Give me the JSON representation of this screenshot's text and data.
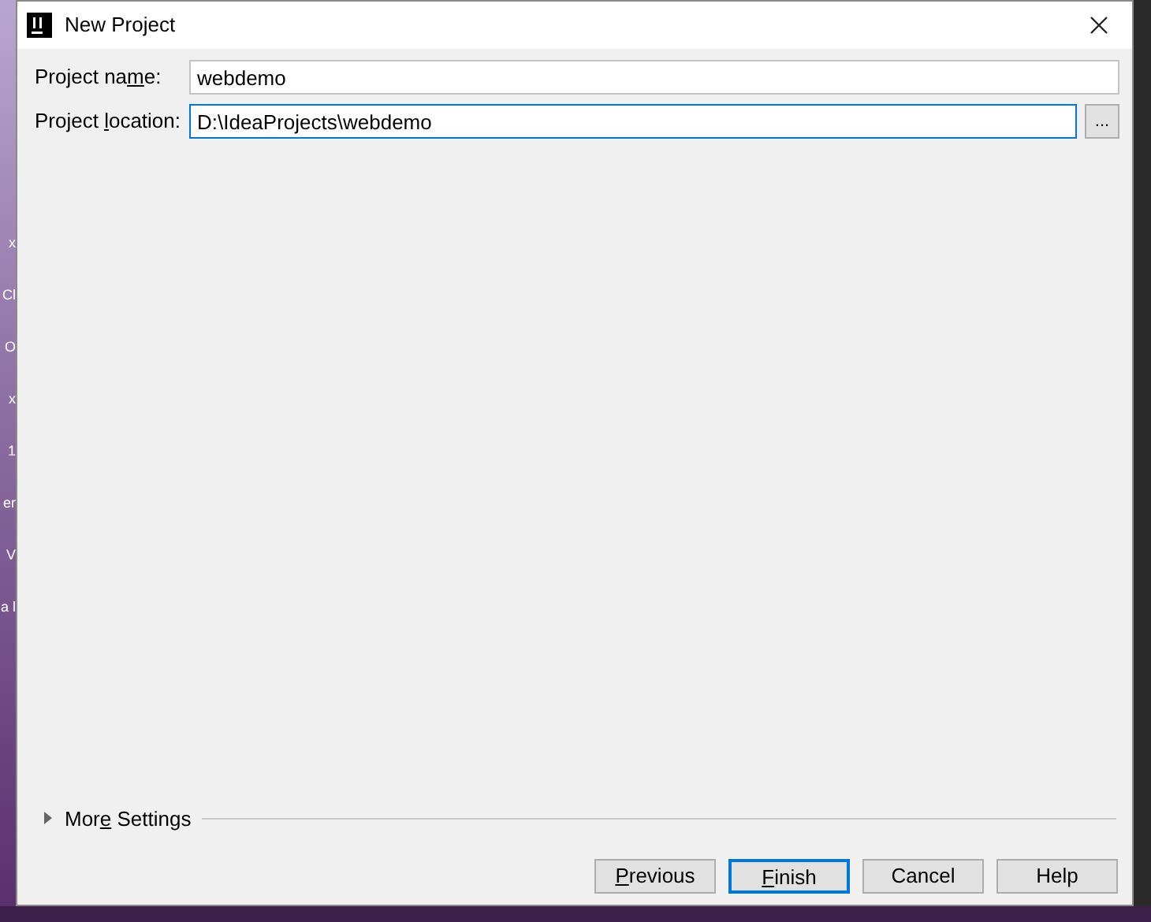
{
  "desktop_fragments": [
    {
      "label": "x"
    },
    {
      "label": "Cl"
    },
    {
      "label": "O"
    },
    {
      "label": "x"
    },
    {
      "label": "1"
    },
    {
      "label": "er"
    },
    {
      "label": "V"
    },
    {
      "label": "a l"
    }
  ],
  "window": {
    "title": "New Project"
  },
  "fields": [
    {
      "label_before": "Project na",
      "mnemonic": "m",
      "label_after": "e:",
      "value": "webdemo",
      "focused": false,
      "browse": false
    },
    {
      "label_before": "Project ",
      "mnemonic": "l",
      "label_after": "ocation:",
      "value": "D:\\IdeaProjects\\webdemo",
      "focused": true,
      "browse": true,
      "browse_label": "..."
    }
  ],
  "more_settings": {
    "label_before": "Mor",
    "mnemonic": "e",
    "label_after": " Settings",
    "expanded": false
  },
  "buttons": [
    {
      "mnemonic": "P",
      "label_after": "revious",
      "default": false
    },
    {
      "mnemonic": "F",
      "label_after": "inish",
      "default": true
    },
    {
      "label_before": "Cancel",
      "default": false
    },
    {
      "label_before": "Help",
      "default": false
    }
  ]
}
